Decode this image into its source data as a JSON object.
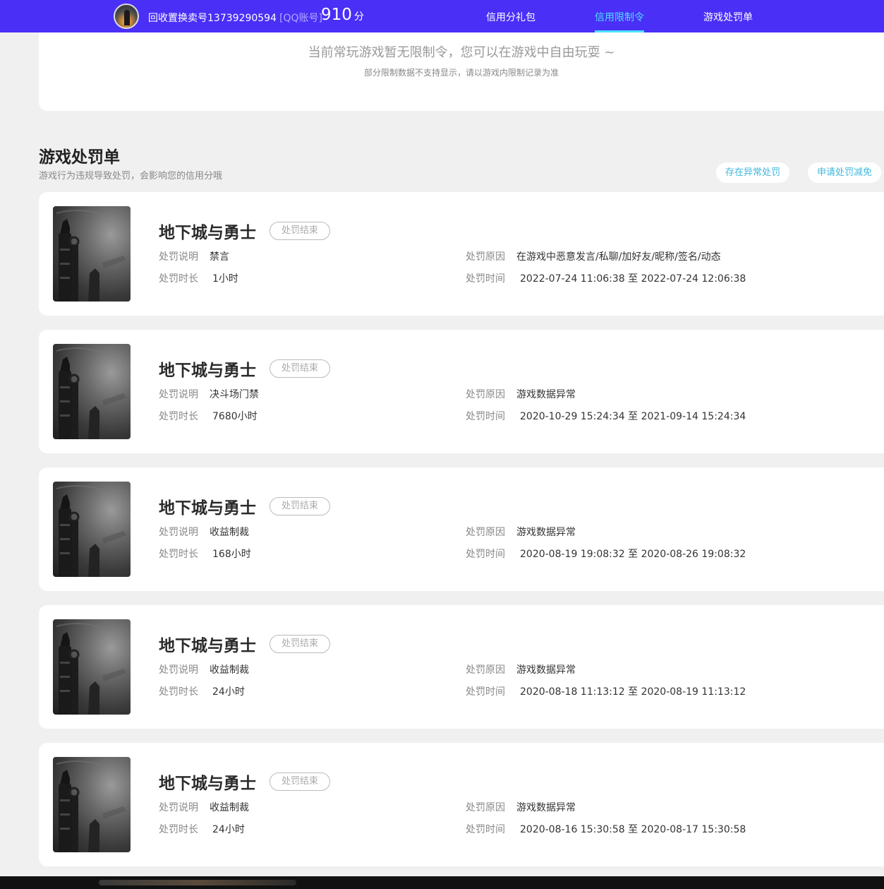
{
  "header": {
    "account_name": "回收置换卖号13739290594",
    "account_type": "[QQ账号]",
    "score": "910",
    "score_unit": "分",
    "tabs": [
      {
        "label": "信用分礼包",
        "active": false
      },
      {
        "label": "信用限制令",
        "active": true
      },
      {
        "label": "游戏处罚单",
        "active": false
      }
    ]
  },
  "limit": {
    "message": "当前常玩游戏暂无限制令，您可以在游戏中自由玩耍 ~",
    "note": "部分限制数据不支持显示，请以游戏内限制记录为准"
  },
  "penalty_section": {
    "title": "游戏处罚单",
    "subtitle": "游戏行为违规导致处罚，会影响您的信用分哦",
    "btn_abnormal": "存在异常处罚",
    "btn_appeal": "申请处罚减免"
  },
  "labels": {
    "desc": "处罚说明",
    "duration": "处罚时长",
    "reason": "处罚原因",
    "time": "处罚时间"
  },
  "penalties": [
    {
      "game": "地下城与勇士",
      "status": "处罚结束",
      "desc": "禁言",
      "duration": "1小时",
      "reason": "在游戏中恶意发言/私聊/加好友/昵称/签名/动态",
      "time": "2022-07-24 11:06:38 至 2022-07-24 12:06:38"
    },
    {
      "game": "地下城与勇士",
      "status": "处罚结束",
      "desc": "决斗场门禁",
      "duration": "7680小时",
      "reason": "游戏数据异常",
      "time": "2020-10-29 15:24:34 至 2021-09-14 15:24:34"
    },
    {
      "game": "地下城与勇士",
      "status": "处罚结束",
      "desc": "收益制裁",
      "duration": "168小时",
      "reason": "游戏数据异常",
      "time": "2020-08-19 19:08:32 至 2020-08-26 19:08:32"
    },
    {
      "game": "地下城与勇士",
      "status": "处罚结束",
      "desc": "收益制裁",
      "duration": "24小时",
      "reason": "游戏数据异常",
      "time": "2020-08-18 11:13:12 至 2020-08-19 11:13:12"
    },
    {
      "game": "地下城与勇士",
      "status": "处罚结束",
      "desc": "收益制裁",
      "duration": "24小时",
      "reason": "游戏数据异常",
      "time": "2020-08-16 15:30:58 至 2020-08-17 15:30:58"
    }
  ]
}
